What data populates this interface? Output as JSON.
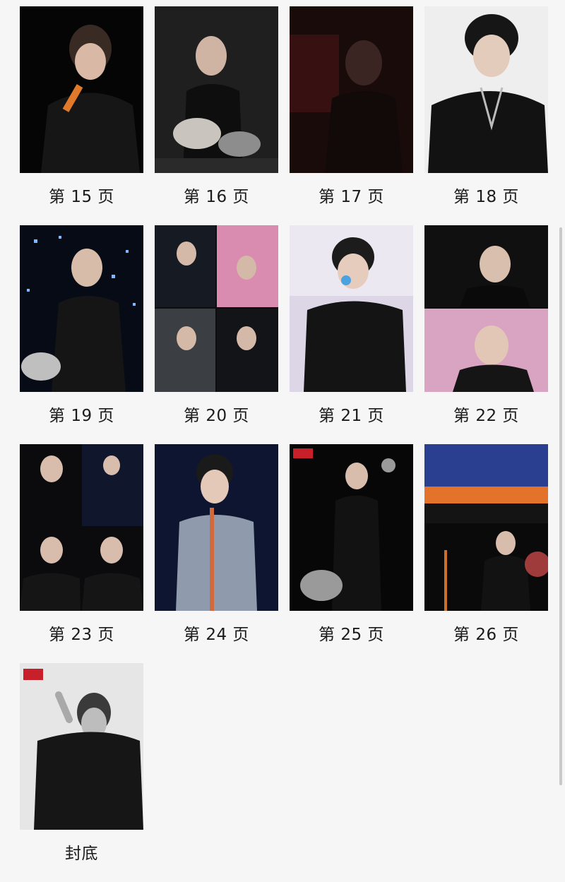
{
  "pages": [
    {
      "label": "第 15 页"
    },
    {
      "label": "第 16 页"
    },
    {
      "label": "第 17 页"
    },
    {
      "label": "第 18 页"
    },
    {
      "label": "第 19 页"
    },
    {
      "label": "第 20 页"
    },
    {
      "label": "第 21 页"
    },
    {
      "label": "第 22 页"
    },
    {
      "label": "第 23 页"
    },
    {
      "label": "第 24 页"
    },
    {
      "label": "第 25 页"
    },
    {
      "label": "第 26 页"
    },
    {
      "label": "封底"
    }
  ]
}
